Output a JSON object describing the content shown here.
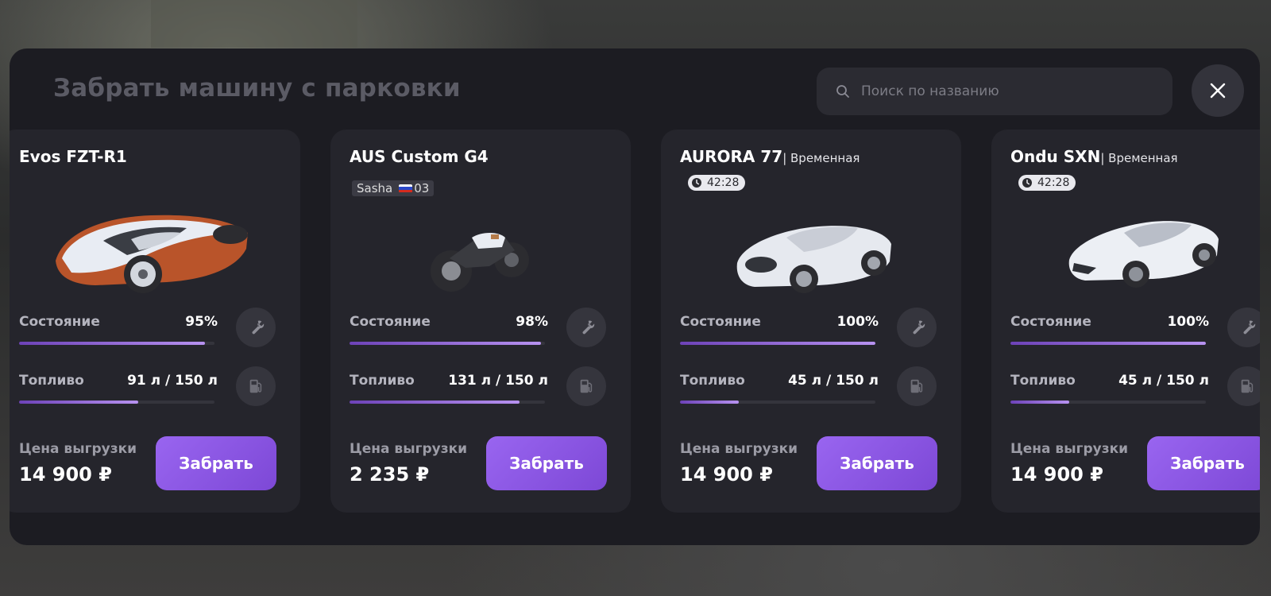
{
  "modal": {
    "title": "Забрать машину с парковки",
    "search_placeholder": "Поиск по названию"
  },
  "colors": {
    "accent": "#8a55e6",
    "card_bg": "#25252c",
    "modal_bg": "#1c1c22"
  },
  "labels": {
    "condition": "Состояние",
    "fuel": "Топливо",
    "price": "Цена выгрузки",
    "take": "Забрать",
    "temporary_tag": "| Временная"
  },
  "cards": [
    {
      "name": "Evos FZT-R1",
      "condition_value": "95%",
      "condition_pct": 95,
      "fuel_value": "91 л / 150 л",
      "fuel_pct": 61,
      "price": "14 900 ₽"
    },
    {
      "name": "AUS Custom G4",
      "owner": "Sasha",
      "plate": "03",
      "condition_value": "98%",
      "condition_pct": 98,
      "fuel_value": "131 л / 150 л",
      "fuel_pct": 87,
      "price": "2 235 ₽"
    },
    {
      "name": "AURORA 77",
      "timer": "42:28",
      "condition_value": "100%",
      "condition_pct": 100,
      "fuel_value": "45 л / 150 л",
      "fuel_pct": 30,
      "price": "14 900 ₽"
    },
    {
      "name": "Ondu SXN",
      "timer": "42:28",
      "condition_value": "100%",
      "condition_pct": 100,
      "fuel_value": "45 л / 150 л",
      "fuel_pct": 30,
      "price": "14 900 ₽"
    }
  ]
}
